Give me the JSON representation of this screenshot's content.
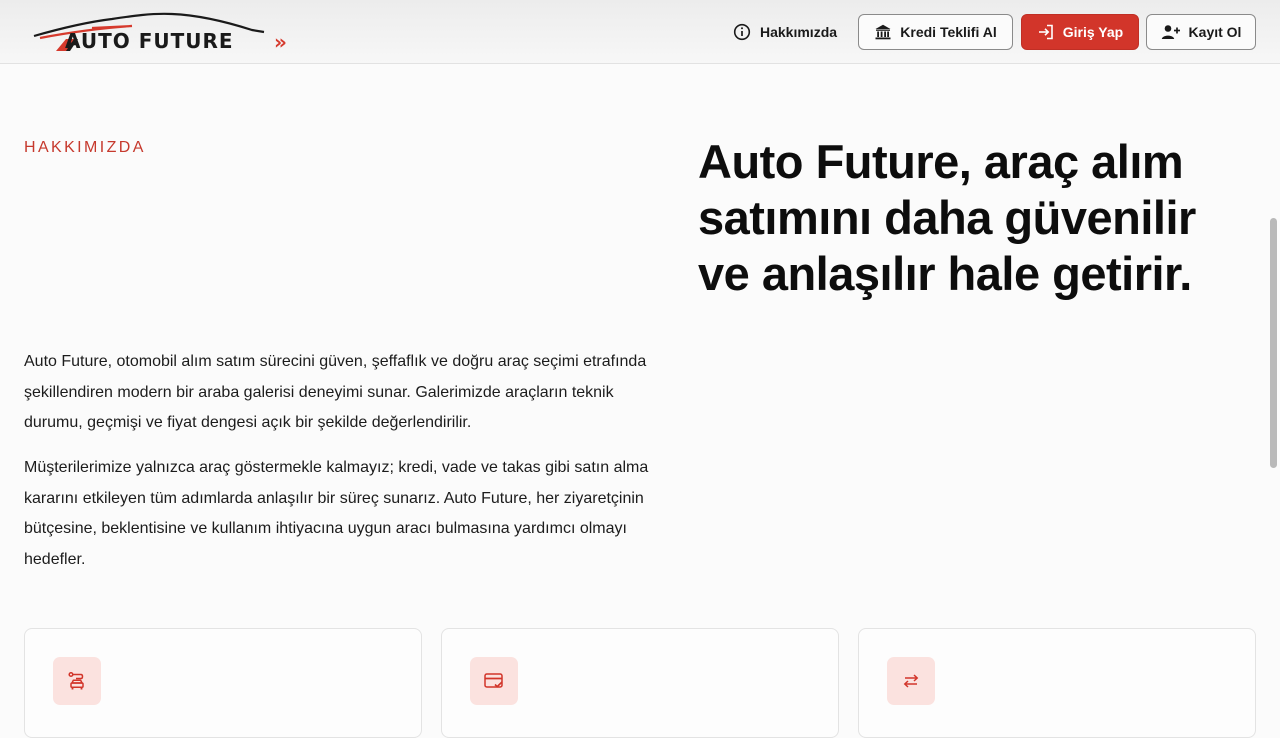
{
  "header": {
    "logo_text": "AUTO FUTURE",
    "logo_arrows": "»",
    "nav_about": "Hakkımızda",
    "credit_button": "Kredi Teklifi Al",
    "login_button": "Giriş Yap",
    "register_button": "Kayıt Ol"
  },
  "hero": {
    "eyebrow": "HAKKIMIZDA",
    "headline": "Auto Future, araç alım satımını daha güvenilir ve anlaşılır hale getirir.",
    "paragraph1": "Auto Future, otomobil alım satım sürecini güven, şeffaflık ve doğru araç seçimi etrafında şekillendiren modern bir araba galerisi deneyimi sunar. Galerimizde araçların teknik durumu, geçmişi ve fiyat dengesi açık bir şekilde değerlendirilir.",
    "paragraph2": "Müşterilerimize yalnızca araç göstermekle kalmayız; kredi, vade ve takas gibi satın alma kararını etkileyen tüm adımlarda anlaşılır bir süreç sunarız. Auto Future, her ziyaretçinin bütçesine, beklentisine ve kullanım ihtiyacına uygun aracı bulmasına yardımcı olmayı hedefler."
  },
  "cards": [
    {
      "icon": "car-route-icon"
    },
    {
      "icon": "credit-card-check-icon"
    },
    {
      "icon": "swap-arrows-icon"
    }
  ],
  "colors": {
    "accent": "#d2352a",
    "eyebrow": "#c6392d",
    "icon_bg": "#fbe2df"
  }
}
